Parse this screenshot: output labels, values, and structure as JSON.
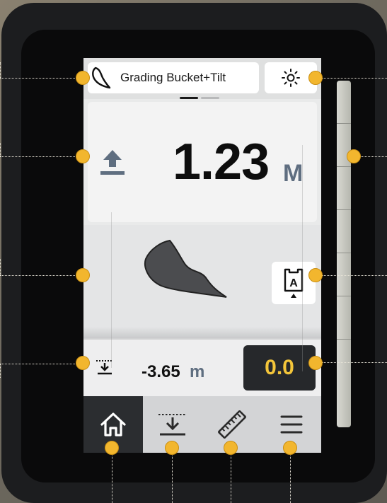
{
  "topbar": {
    "tool_label": "Grading Bucket+Tilt",
    "tool_icon": "bucket-profile-icon",
    "brightness_icon": "sun-icon"
  },
  "height_panel": {
    "value": "1.23",
    "unit": "M",
    "icon": "arrow-up-to-line-icon"
  },
  "bucket_view": {
    "auto_button_letter": "A",
    "auto_icon": "auto-tilt-icon"
  },
  "depth_panel": {
    "value": "-3.65",
    "unit": "m",
    "icon": "depth-target-icon",
    "offset_value": "0.0"
  },
  "navbar": {
    "items": [
      {
        "name": "home",
        "icon": "home-icon",
        "active": true
      },
      {
        "name": "depth",
        "icon": "target-depth-icon",
        "active": false
      },
      {
        "name": "measure",
        "icon": "ruler-icon",
        "active": false
      },
      {
        "name": "menu",
        "icon": "menu-icon",
        "active": false
      }
    ]
  },
  "colors": {
    "accent": "#f3c53a",
    "callout": "#f2b62e",
    "unit_blue": "#5f6e80",
    "nav_active": "#2b2d30"
  }
}
